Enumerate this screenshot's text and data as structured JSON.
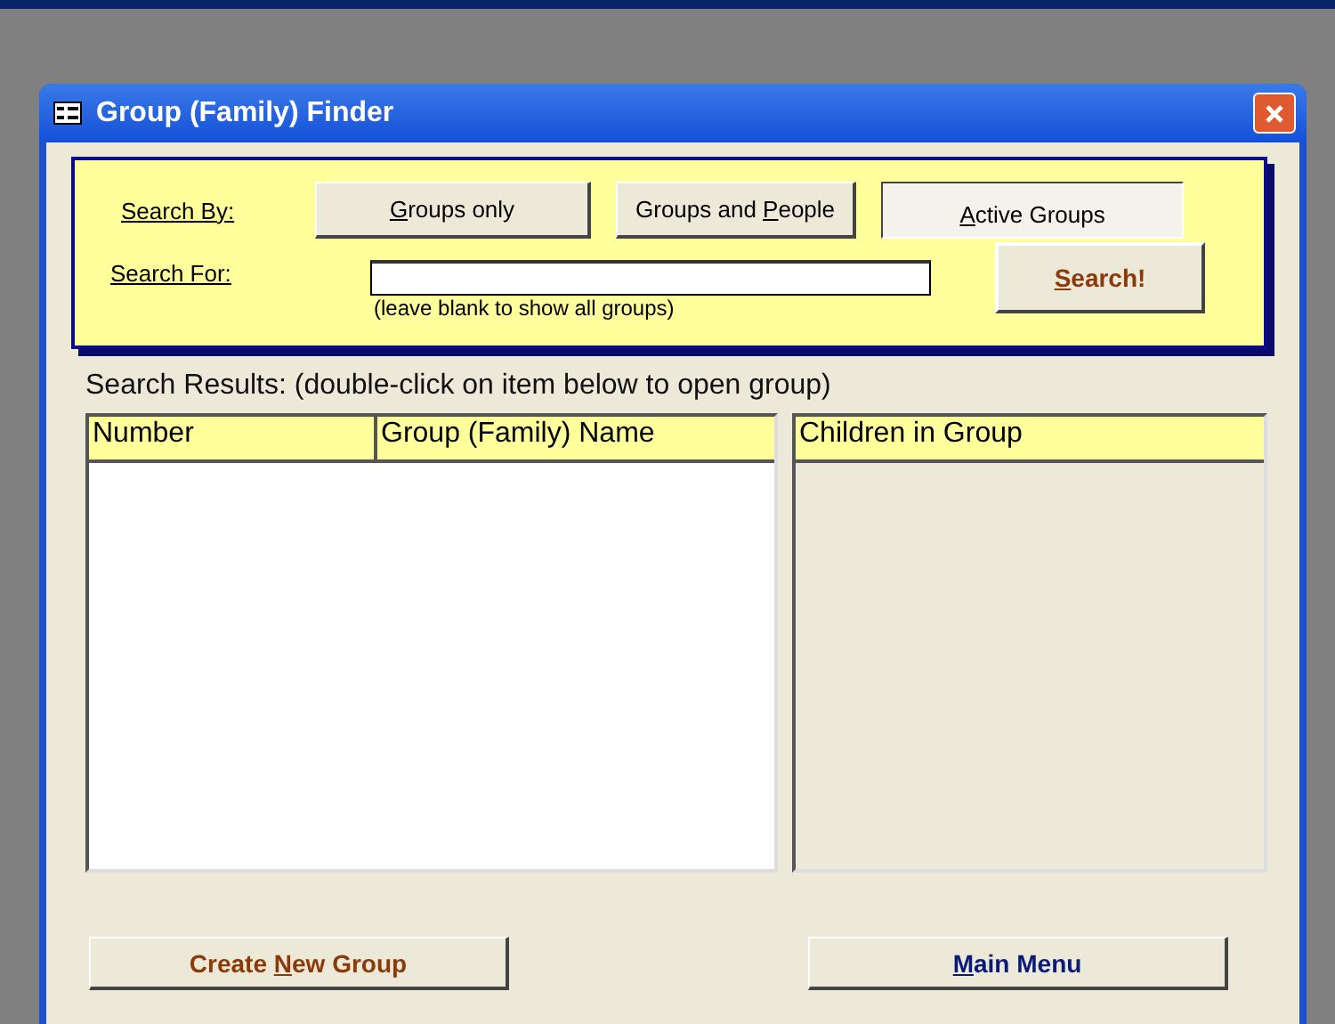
{
  "window": {
    "title": "Group (Family) Finder"
  },
  "search_by": {
    "label": "Search By:",
    "options": [
      {
        "key": "G",
        "after": "roups only",
        "selected": false
      },
      {
        "before": "Groups and ",
        "key": "P",
        "after": "eople",
        "selected": false
      },
      {
        "key": "A",
        "after": "ctive Groups",
        "selected": true
      }
    ]
  },
  "search_for": {
    "label": "Search For:",
    "hint": "(leave blank to show all groups)",
    "button": {
      "key": "S",
      "after": "earch!"
    }
  },
  "results_label": "Search Results: (double-click on item below to open group)",
  "table": {
    "columns": [
      "Number",
      "Group (Family) Name"
    ]
  },
  "children": {
    "columns": [
      "Children in Group"
    ]
  },
  "buttons": [
    {
      "kind": "create",
      "before": "Create ",
      "key": "N",
      "after": "ew Group"
    },
    {
      "kind": "menu",
      "key": "M",
      "after": "ain Menu"
    }
  ]
}
